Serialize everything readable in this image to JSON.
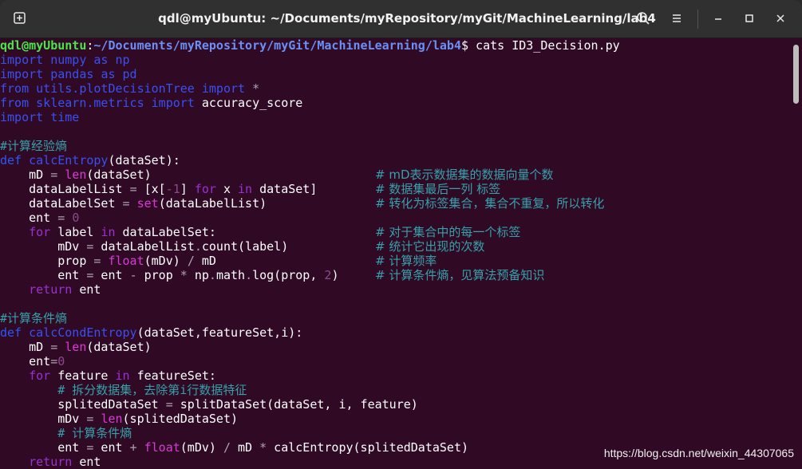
{
  "window": {
    "title": "qdl@myUbuntu: ~/Documents/myRepository/myGit/MachineLearning/lab4",
    "buttons": {
      "new_tab": "new-tab",
      "search": "search",
      "menu": "menu",
      "minimize": "minimize",
      "maximize": "maximize",
      "close": "close"
    }
  },
  "colors": {
    "background": "#300a24",
    "prompt_user": "#4ae54a",
    "prompt_path": "#6b8ff5",
    "keyword_import": "#3a50f0",
    "keyword_def": "#2f57f5",
    "keyword_control": "#9b30d0",
    "function_name": "#3a50f0",
    "builtin": "#d63bd6",
    "comment": "#37a0aa",
    "number": "#8a4a8a",
    "operator": "#b0a0b0",
    "text": "#ffffff"
  },
  "terminal": {
    "lines": [
      {
        "segs": [
          {
            "t": "qdl@myUbuntu",
            "c": "prompt_user",
            "b": true
          },
          {
            "t": ":",
            "c": "text"
          },
          {
            "t": "~/Documents/myRepository/myGit/MachineLearning/lab4",
            "c": "prompt_path",
            "b": true
          },
          {
            "t": "$ cats ID3_Decision.py",
            "c": "text"
          }
        ]
      },
      {
        "segs": [
          {
            "t": "import",
            "c": "keyword_import"
          },
          {
            "t": " ",
            "c": "text"
          },
          {
            "t": "numpy",
            "c": "keyword_import"
          },
          {
            "t": " ",
            "c": "text"
          },
          {
            "t": "as",
            "c": "keyword_import"
          },
          {
            "t": " ",
            "c": "text"
          },
          {
            "t": "np",
            "c": "keyword_import"
          }
        ]
      },
      {
        "segs": [
          {
            "t": "import",
            "c": "keyword_import"
          },
          {
            "t": " ",
            "c": "text"
          },
          {
            "t": "pandas",
            "c": "keyword_import"
          },
          {
            "t": " ",
            "c": "text"
          },
          {
            "t": "as",
            "c": "keyword_import"
          },
          {
            "t": " ",
            "c": "text"
          },
          {
            "t": "pd",
            "c": "keyword_import"
          }
        ]
      },
      {
        "segs": [
          {
            "t": "from",
            "c": "keyword_import"
          },
          {
            "t": " ",
            "c": "text"
          },
          {
            "t": "utils.plotDecisionTree",
            "c": "keyword_import"
          },
          {
            "t": " ",
            "c": "text"
          },
          {
            "t": "import",
            "c": "keyword_import"
          },
          {
            "t": " *",
            "c": "operator"
          }
        ]
      },
      {
        "segs": [
          {
            "t": "from",
            "c": "keyword_import"
          },
          {
            "t": " ",
            "c": "text"
          },
          {
            "t": "sklearn.metrics",
            "c": "keyword_import"
          },
          {
            "t": " ",
            "c": "text"
          },
          {
            "t": "import",
            "c": "keyword_import"
          },
          {
            "t": " accuracy_score",
            "c": "text"
          }
        ]
      },
      {
        "segs": [
          {
            "t": "import",
            "c": "keyword_import"
          },
          {
            "t": " ",
            "c": "text"
          },
          {
            "t": "time",
            "c": "keyword_import"
          }
        ]
      },
      {
        "segs": []
      },
      {
        "segs": [
          {
            "t": "#计算经验熵",
            "c": "comment"
          }
        ]
      },
      {
        "segs": [
          {
            "t": "def",
            "c": "keyword_def"
          },
          {
            "t": " ",
            "c": "text"
          },
          {
            "t": "calcEntropy",
            "c": "function_name"
          },
          {
            "t": "(dataSet):",
            "c": "text"
          }
        ]
      },
      {
        "segs": [
          {
            "t": "    mD ",
            "c": "text"
          },
          {
            "t": "=",
            "c": "operator"
          },
          {
            "t": " ",
            "c": "text"
          },
          {
            "t": "len",
            "c": "builtin"
          },
          {
            "t": "(dataSet)",
            "c": "text"
          }
        ],
        "cm": "# mD表示数据集的数据向量个数"
      },
      {
        "segs": [
          {
            "t": "    dataLabelList ",
            "c": "text"
          },
          {
            "t": "=",
            "c": "operator"
          },
          {
            "t": " [x[",
            "c": "text"
          },
          {
            "t": "-1",
            "c": "number"
          },
          {
            "t": "] ",
            "c": "text"
          },
          {
            "t": "for",
            "c": "keyword_control"
          },
          {
            "t": " x ",
            "c": "text"
          },
          {
            "t": "in",
            "c": "keyword_control"
          },
          {
            "t": " dataSet]",
            "c": "text"
          }
        ],
        "cm": "# 数据集最后一列 标签"
      },
      {
        "segs": [
          {
            "t": "    dataLabelSet ",
            "c": "text"
          },
          {
            "t": "=",
            "c": "operator"
          },
          {
            "t": " ",
            "c": "text"
          },
          {
            "t": "set",
            "c": "builtin"
          },
          {
            "t": "(dataLabelList)",
            "c": "text"
          }
        ],
        "cm": "# 转化为标签集合，集合不重复，所以转化"
      },
      {
        "segs": [
          {
            "t": "    ent ",
            "c": "text"
          },
          {
            "t": "=",
            "c": "operator"
          },
          {
            "t": " ",
            "c": "text"
          },
          {
            "t": "0",
            "c": "number"
          }
        ]
      },
      {
        "segs": [
          {
            "t": "    ",
            "c": "text"
          },
          {
            "t": "for",
            "c": "keyword_control"
          },
          {
            "t": " label ",
            "c": "text"
          },
          {
            "t": "in",
            "c": "keyword_control"
          },
          {
            "t": " dataLabelSet:",
            "c": "text"
          }
        ],
        "cm": "# 对于集合中的每一个标签"
      },
      {
        "segs": [
          {
            "t": "        mDv ",
            "c": "text"
          },
          {
            "t": "=",
            "c": "operator"
          },
          {
            "t": " dataLabelList",
            "c": "text"
          },
          {
            "t": ".",
            "c": "operator"
          },
          {
            "t": "count(label)",
            "c": "text"
          }
        ],
        "cm": "# 统计它出现的次数"
      },
      {
        "segs": [
          {
            "t": "        prop ",
            "c": "text"
          },
          {
            "t": "=",
            "c": "operator"
          },
          {
            "t": " ",
            "c": "text"
          },
          {
            "t": "float",
            "c": "builtin"
          },
          {
            "t": "(mDv) ",
            "c": "text"
          },
          {
            "t": "/",
            "c": "operator"
          },
          {
            "t": " mD",
            "c": "text"
          }
        ],
        "cm": "# 计算频率"
      },
      {
        "segs": [
          {
            "t": "        ent ",
            "c": "text"
          },
          {
            "t": "=",
            "c": "operator"
          },
          {
            "t": " ent ",
            "c": "text"
          },
          {
            "t": "-",
            "c": "operator"
          },
          {
            "t": " prop ",
            "c": "text"
          },
          {
            "t": "*",
            "c": "operator"
          },
          {
            "t": " np",
            "c": "text"
          },
          {
            "t": ".",
            "c": "operator"
          },
          {
            "t": "math",
            "c": "text"
          },
          {
            "t": ".",
            "c": "operator"
          },
          {
            "t": "log(prop, ",
            "c": "text"
          },
          {
            "t": "2",
            "c": "number"
          },
          {
            "t": ")",
            "c": "text"
          }
        ],
        "cm": "# 计算条件熵，见算法预备知识"
      },
      {
        "segs": [
          {
            "t": "    ",
            "c": "text"
          },
          {
            "t": "return",
            "c": "keyword_control"
          },
          {
            "t": " ent",
            "c": "text"
          }
        ]
      },
      {
        "segs": []
      },
      {
        "segs": [
          {
            "t": "#计算条件熵",
            "c": "comment"
          }
        ]
      },
      {
        "segs": [
          {
            "t": "def",
            "c": "keyword_def"
          },
          {
            "t": " ",
            "c": "text"
          },
          {
            "t": "calcCondEntropy",
            "c": "function_name"
          },
          {
            "t": "(dataSet,featureSet,i):",
            "c": "text"
          }
        ]
      },
      {
        "segs": [
          {
            "t": "    mD ",
            "c": "text"
          },
          {
            "t": "=",
            "c": "operator"
          },
          {
            "t": " ",
            "c": "text"
          },
          {
            "t": "len",
            "c": "builtin"
          },
          {
            "t": "(dataSet)",
            "c": "text"
          }
        ]
      },
      {
        "segs": [
          {
            "t": "    ent",
            "c": "text"
          },
          {
            "t": "=",
            "c": "operator"
          },
          {
            "t": "0",
            "c": "number"
          }
        ]
      },
      {
        "segs": [
          {
            "t": "    ",
            "c": "text"
          },
          {
            "t": "for",
            "c": "keyword_control"
          },
          {
            "t": " feature ",
            "c": "text"
          },
          {
            "t": "in",
            "c": "keyword_control"
          },
          {
            "t": " featureSet:",
            "c": "text"
          }
        ]
      },
      {
        "segs": [
          {
            "t": "        # 拆分数据集，去除第i行数据特征",
            "c": "comment"
          }
        ]
      },
      {
        "segs": [
          {
            "t": "        splitedDataSet ",
            "c": "text"
          },
          {
            "t": "=",
            "c": "operator"
          },
          {
            "t": " splitDataSet(dataSet, i, feature)",
            "c": "text"
          }
        ]
      },
      {
        "segs": [
          {
            "t": "        mDv ",
            "c": "text"
          },
          {
            "t": "=",
            "c": "operator"
          },
          {
            "t": " ",
            "c": "text"
          },
          {
            "t": "len",
            "c": "builtin"
          },
          {
            "t": "(splitedDataSet)",
            "c": "text"
          }
        ]
      },
      {
        "segs": [
          {
            "t": "        # 计算条件熵",
            "c": "comment"
          }
        ]
      },
      {
        "segs": [
          {
            "t": "        ent ",
            "c": "text"
          },
          {
            "t": "=",
            "c": "operator"
          },
          {
            "t": " ent ",
            "c": "text"
          },
          {
            "t": "+",
            "c": "operator"
          },
          {
            "t": " ",
            "c": "text"
          },
          {
            "t": "float",
            "c": "builtin"
          },
          {
            "t": "(mDv) ",
            "c": "text"
          },
          {
            "t": "/",
            "c": "operator"
          },
          {
            "t": " mD ",
            "c": "text"
          },
          {
            "t": "*",
            "c": "operator"
          },
          {
            "t": " calcEntropy(splitedDataSet)",
            "c": "text"
          }
        ]
      },
      {
        "segs": [
          {
            "t": "    ",
            "c": "text"
          },
          {
            "t": "return",
            "c": "keyword_control"
          },
          {
            "t": " ent",
            "c": "text"
          }
        ]
      }
    ]
  },
  "watermark": "https://blog.csdn.net/weixin_44307065"
}
